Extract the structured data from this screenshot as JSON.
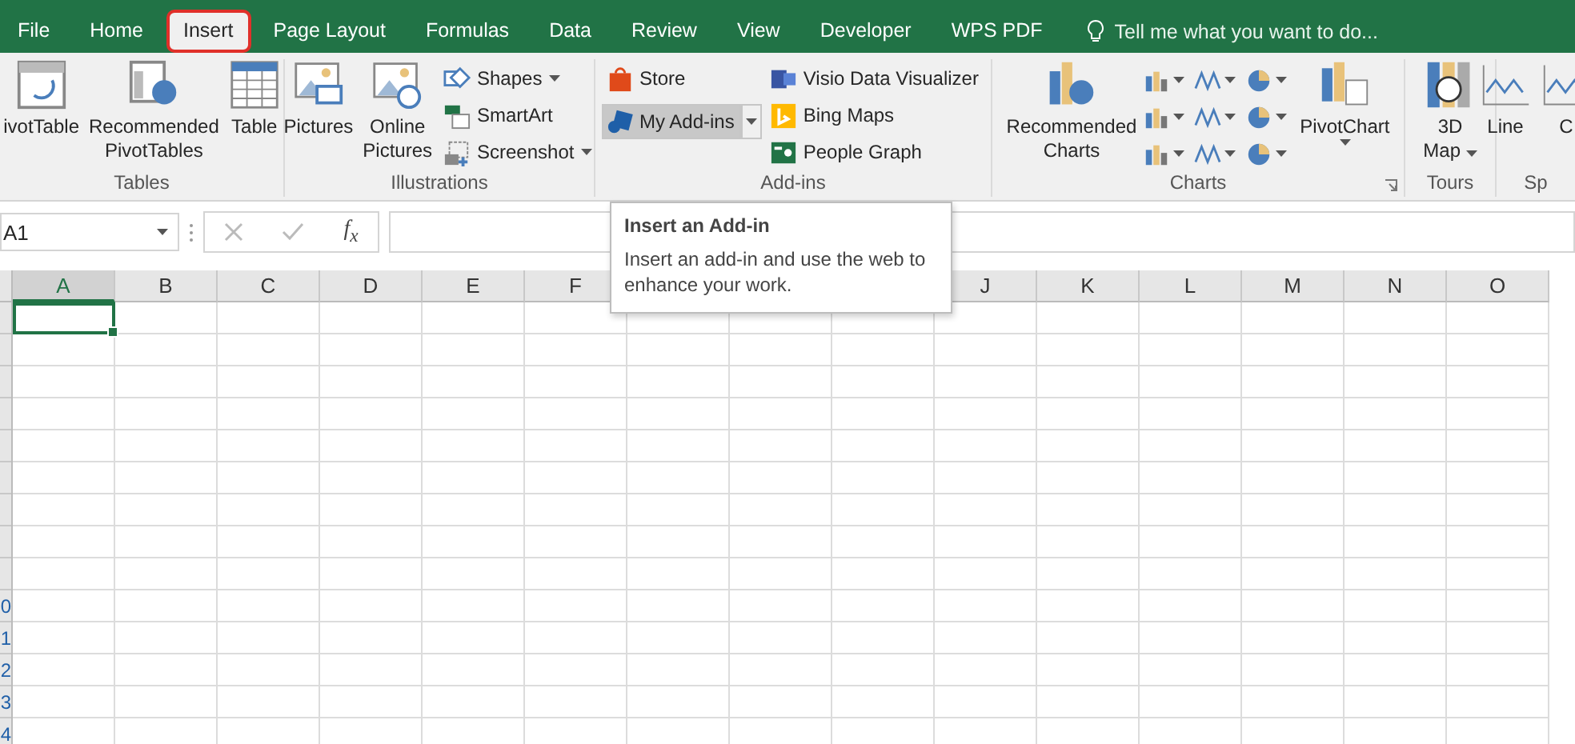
{
  "tabs": [
    {
      "label": "File",
      "selected": false
    },
    {
      "label": "Home",
      "selected": false
    },
    {
      "label": "Insert",
      "selected": true
    },
    {
      "label": "Page Layout",
      "selected": false
    },
    {
      "label": "Formulas",
      "selected": false
    },
    {
      "label": "Data",
      "selected": false
    },
    {
      "label": "Review",
      "selected": false
    },
    {
      "label": "View",
      "selected": false
    },
    {
      "label": "Developer",
      "selected": false
    },
    {
      "label": "WPS PDF",
      "selected": false
    }
  ],
  "tell_me": {
    "placeholder": "Tell me what you want to do..."
  },
  "ribbon": {
    "groups": [
      {
        "label": "Tables",
        "items": [
          {
            "kind": "big",
            "label": "ivotTable"
          },
          {
            "kind": "big",
            "label": "Recommended PivotTables"
          },
          {
            "kind": "big",
            "label": "Table"
          }
        ]
      },
      {
        "label": "Illustrations",
        "items": [
          {
            "kind": "big",
            "label": "Pictures"
          },
          {
            "kind": "big",
            "label": "Online Pictures"
          },
          {
            "kind": "stack",
            "items": [
              {
                "kind": "small",
                "label": "Shapes",
                "caret": true
              },
              {
                "kind": "small",
                "label": "SmartArt",
                "caret": false
              },
              {
                "kind": "small",
                "label": "Screenshot",
                "caret": true
              }
            ]
          }
        ]
      },
      {
        "label": "Add-ins",
        "items": [
          {
            "kind": "stack",
            "items": [
              {
                "kind": "small",
                "label": "Store",
                "caret": false
              },
              {
                "kind": "split",
                "label": "My Add-ins",
                "highlighted": true
              }
            ]
          },
          {
            "kind": "stack",
            "items": [
              {
                "kind": "small",
                "label": "Visio Data Visualizer",
                "caret": false
              },
              {
                "kind": "small",
                "label": "Bing Maps",
                "caret": false
              },
              {
                "kind": "small",
                "label": "People Graph",
                "caret": false
              }
            ]
          }
        ]
      },
      {
        "label": "Charts",
        "items": [
          {
            "kind": "big",
            "label": "Recommended Charts",
            "caret": false
          },
          {
            "kind": "gallery"
          },
          {
            "kind": "big",
            "label": "PivotChart",
            "caret": true
          }
        ]
      },
      {
        "label": "Tours",
        "items": [
          {
            "kind": "big",
            "label": "3D Map",
            "caret": true
          }
        ]
      },
      {
        "label": "Sp",
        "items": [
          {
            "kind": "big",
            "label": "Line"
          },
          {
            "kind": "big",
            "label": "C"
          }
        ]
      }
    ]
  },
  "name_box": {
    "value": "A1"
  },
  "formula_bar": {
    "function_label": "f$_{x}$"
  },
  "columns": [
    {
      "label": "A",
      "selected": true
    },
    {
      "label": "B",
      "selected": false
    },
    {
      "label": "C",
      "selected": false
    },
    {
      "label": "D",
      "selected": false
    },
    {
      "label": "E",
      "selected": false
    },
    {
      "label": "F",
      "selected": false
    }
  ],
  "columns_past_tooltip": [
    {
      "label": "J",
      "selected": false
    },
    {
      "label": "K",
      "selected": false
    },
    {
      "label": "L",
      "selected": false
    },
    {
      "label": "M",
      "selected": false
    },
    {
      "label": "N",
      "selected": false
    },
    {
      "label": "O",
      "selected": false
    }
  ],
  "row_labels": [
    "0",
    "1",
    "2",
    "3",
    "4"
  ],
  "tooltip": {
    "title": "Insert an Add-in",
    "body": "Insert an add-in and use the web to enhance your work."
  }
}
